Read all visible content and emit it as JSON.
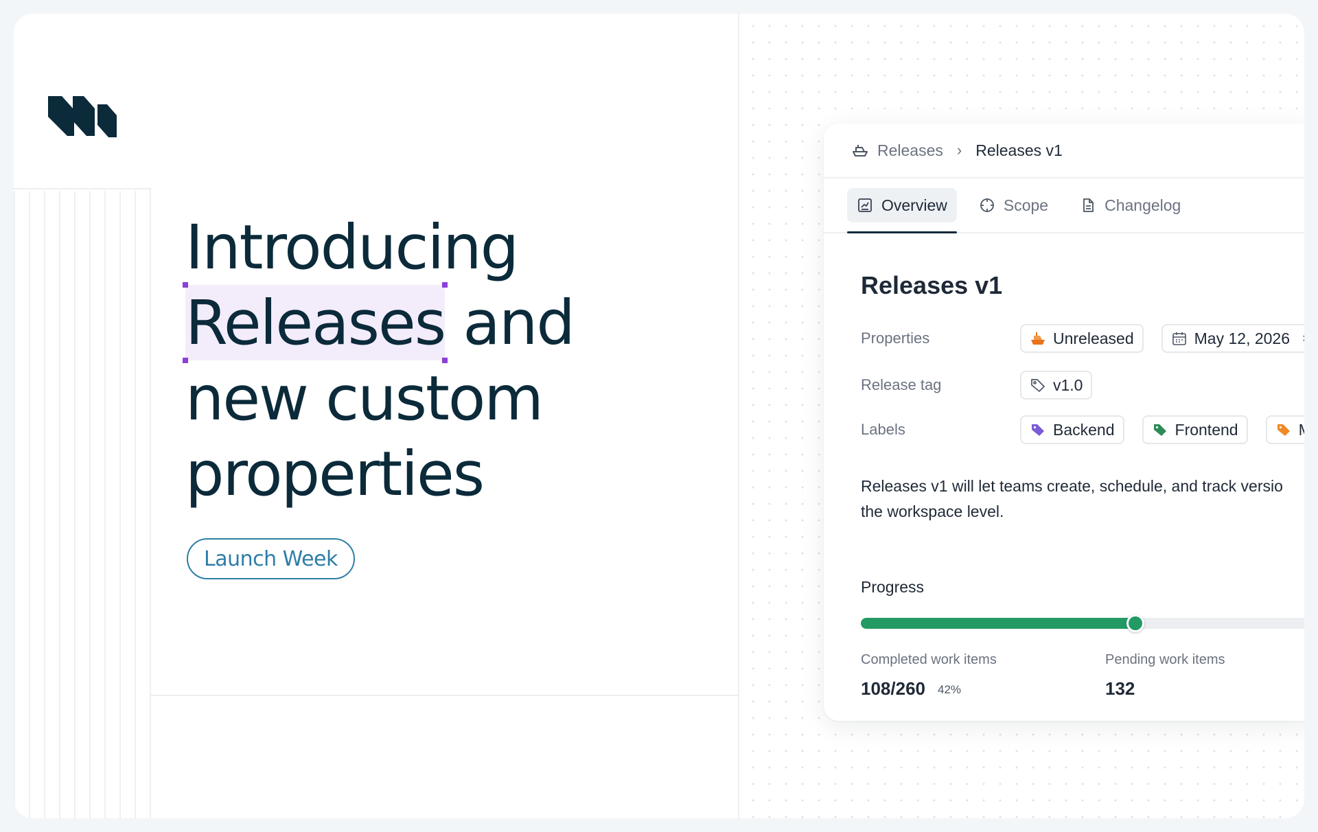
{
  "hero": {
    "headline_line1": "Introducing",
    "headline_highlight": "Releases",
    "headline_line2_rest": " and",
    "headline_line3": "new custom",
    "headline_line4": "properties",
    "pill_label": "Launch Week"
  },
  "breadcrumb": {
    "parent": "Releases",
    "separator": "›",
    "current": "Releases v1"
  },
  "tabs": [
    {
      "label": "Overview",
      "icon": "chart-icon",
      "active": true
    },
    {
      "label": "Scope",
      "icon": "target-icon",
      "active": false
    },
    {
      "label": "Changelog",
      "icon": "document-icon",
      "active": false
    }
  ],
  "release": {
    "title": "Releases v1",
    "properties_label": "Properties",
    "status": "Unreleased",
    "date": "May 12, 2026",
    "date_clear": "×",
    "release_tag_label": "Release tag",
    "release_tag": "v1.0",
    "labels_label": "Labels",
    "labels": [
      {
        "name": "Backend",
        "color": "#7c5cd6"
      },
      {
        "name": "Frontend",
        "color": "#2e8b57"
      },
      {
        "name": "Mobile",
        "color": "#f08a24"
      }
    ],
    "description_line1": "Releases v1 will let teams create, schedule, and track versio",
    "description_line2": "the workspace level."
  },
  "progress": {
    "label": "Progress",
    "fraction": 0.42,
    "completed_label": "Completed work items",
    "completed_value": "108/260",
    "completed_percent": "42%",
    "pending_label": "Pending work items",
    "pending_value": "132"
  },
  "colors": {
    "accent_green": "#239a63",
    "headline": "#0b2a3a",
    "pill": "#2e7ea6",
    "selection": "#8b40d9",
    "status_orange": "#e8731a"
  }
}
